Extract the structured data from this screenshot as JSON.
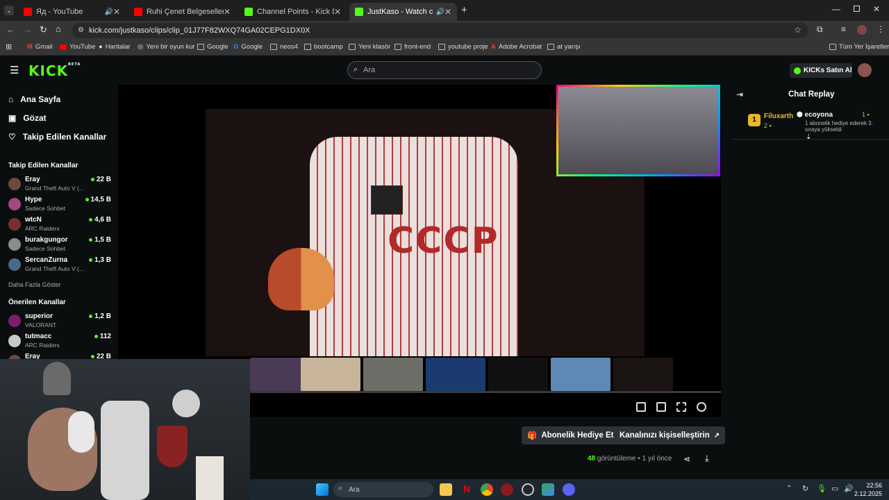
{
  "tabs": [
    {
      "title": "Яд - YouTube",
      "icon": "youtube-icon",
      "audio": true
    },
    {
      "title": "Ruhi Çenet Belgeselleri - YouTube",
      "icon": "youtube-icon"
    },
    {
      "title": "Channel Points - Kick Dashboard",
      "icon": "kick-icon"
    },
    {
      "title": "JustKaso - Watch clips on Kick",
      "icon": "kick-icon",
      "active": true,
      "audio": true
    }
  ],
  "address": {
    "url": "kick.com/justkaso/clips/clip_01J77F82WXQ74GA02CEPG1DX0X"
  },
  "bookmarks": [
    "Gmail",
    "YouTube",
    "Haritalar",
    "Yeni bir oyun kur",
    "Google",
    "Google",
    "neos4",
    "bootcamp",
    "Yeni klasör",
    "front-end",
    "youtube proje",
    "Adobe Acrobat",
    "at yarışı"
  ],
  "bookmarks_right": "Tüm Yer İşaretleri",
  "header": {
    "logo": "KICK",
    "logo_badge": "BETA",
    "search_placeholder": "Ara",
    "kicks_label": "KICKs Satın Al"
  },
  "nav": [
    {
      "label": "Ana Sayfa",
      "icon": "home-icon"
    },
    {
      "label": "Gözat",
      "icon": "browse-icon"
    },
    {
      "label": "Takip Edilen Kanallar",
      "icon": "heart-icon"
    }
  ],
  "followed_heading": "Takip Edilen Kanallar",
  "followed": [
    {
      "name": "Eray",
      "game": "Grand Theft Auto V (...",
      "viewers": "22 B"
    },
    {
      "name": "Hype",
      "game": "Sadece Sohbet",
      "viewers": "14,5 B"
    },
    {
      "name": "wtcN",
      "game": "ARC Raiders",
      "viewers": "4,6 B"
    },
    {
      "name": "burakgungor",
      "game": "Sadece Sohbet",
      "viewers": "1,5 B"
    },
    {
      "name": "SercanZurna",
      "game": "Grand Theft Auto V (...",
      "viewers": "1,3 B"
    }
  ],
  "show_more": "Daha Fazla Göster",
  "recommended_heading": "Önerilen Kanallar",
  "recommended": [
    {
      "name": "superior",
      "game": "VALORANT",
      "viewers": "1,2 B"
    },
    {
      "name": "tutmacc",
      "game": "ARC Raiders",
      "viewers": "112"
    },
    {
      "name": "Eray",
      "game": "",
      "viewers": "22 B"
    }
  ],
  "video": {
    "shirt_text": "CCCP"
  },
  "actions": {
    "gift_sub": "Abonelik Hediye Et",
    "customize": "Kanalınızı kişiselleştirin"
  },
  "stats": {
    "views": "48",
    "views_label": "görüntüleme",
    "time": "1 yıl önce"
  },
  "chat": {
    "title": "Chat Replay",
    "messages": [
      {
        "rank": "1",
        "user": "Filuxarth",
        "points": "2",
        "target": "ecoyona",
        "count": "1",
        "text": "1 abonelik hediye ederek 3. sıraya yükseldi"
      }
    ]
  },
  "taskbar": {
    "search_placeholder": "Ara",
    "time": "22:56",
    "date": "2.12.2025"
  }
}
